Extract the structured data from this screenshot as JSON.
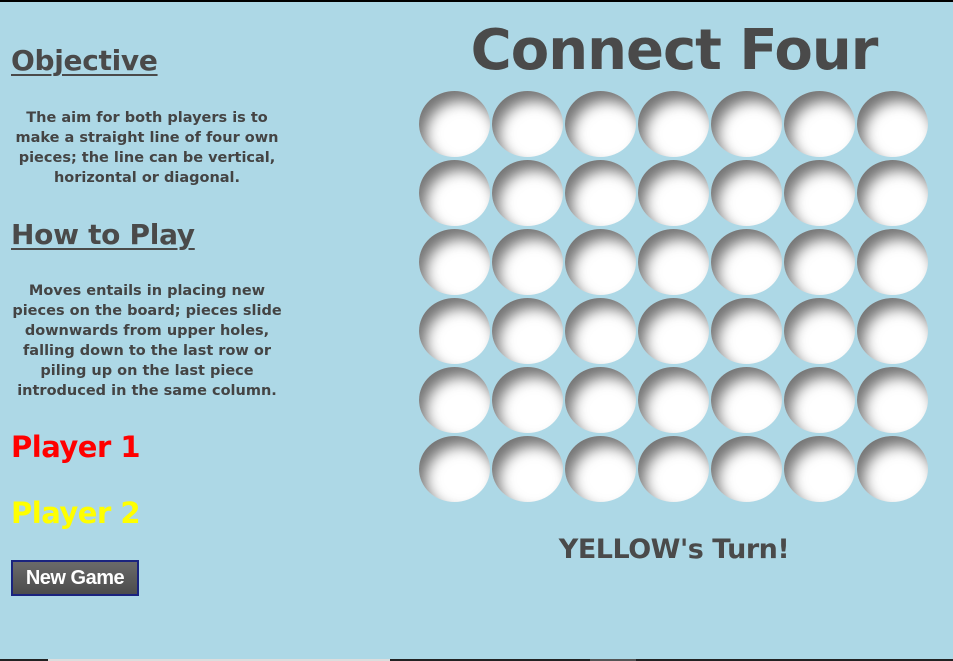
{
  "sidebar": {
    "objective_title": "Objective",
    "objective_text": "The aim for both players is to make a straight line of four own pieces; the line can be vertical, horizontal or diagonal.",
    "howto_title": "How to Play",
    "howto_text": "Moves entails in placing new pieces on the board; pieces slide downwards from upper holes, falling down to the last row or piling up on the last piece introduced in the same column.",
    "player1": "Player 1",
    "player2": "Player 2",
    "new_game_label": "New Game"
  },
  "game": {
    "title": "Connect Four",
    "turn_text": "YELLOW's Turn!",
    "rows": 6,
    "columns": 7,
    "board": [
      [
        "empty",
        "empty",
        "empty",
        "empty",
        "empty",
        "empty",
        "empty"
      ],
      [
        "empty",
        "empty",
        "empty",
        "empty",
        "empty",
        "empty",
        "empty"
      ],
      [
        "empty",
        "empty",
        "empty",
        "empty",
        "empty",
        "empty",
        "empty"
      ],
      [
        "empty",
        "empty",
        "empty",
        "empty",
        "empty",
        "empty",
        "empty"
      ],
      [
        "empty",
        "empty",
        "empty",
        "empty",
        "empty",
        "empty",
        "empty"
      ],
      [
        "empty",
        "empty",
        "empty",
        "empty",
        "empty",
        "empty",
        "empty"
      ]
    ]
  },
  "colors": {
    "background": "#add8e6",
    "text": "#4a4a4a",
    "player1": "#ff0000",
    "player2": "#ffff00",
    "hole_empty": "#ffffff"
  }
}
